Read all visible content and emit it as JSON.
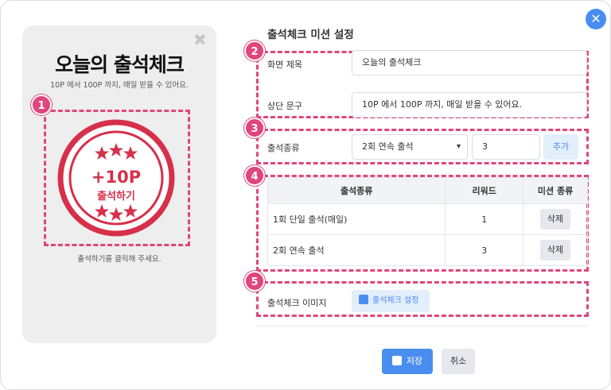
{
  "dialog": {
    "close_icon": "close-icon"
  },
  "preview": {
    "close_glyph": "✖",
    "title": "오늘의 출석체크",
    "subtitle": "10P 에서 100P 까지, 매일 받을 수 있어요.",
    "stamp_points": "+10P",
    "stamp_label": "출석하기",
    "hint": "출석하기를 클릭해 주세요."
  },
  "settings": {
    "title": "출석체크 미션 설정",
    "screen_title_label": "화면 제목",
    "screen_title_value": "오늘의 출석체크",
    "top_text_label": "상단 문구",
    "top_text_value": "10P 에서 100P 까지, 매일 받을 수 있어요.",
    "type_label": "출석종류",
    "type_selected": "2회 연속 출석",
    "type_reward_value": "3",
    "add_button": "추가",
    "image_label": "출석체크 이미지",
    "image_button": "출석체크 설정"
  },
  "table": {
    "headers": [
      "출석종류",
      "리워드",
      "미션 종류"
    ],
    "rows": [
      {
        "type": "1회 단일 출석(매일)",
        "reward": "1",
        "action": "삭제"
      },
      {
        "type": "2회 연속 출석",
        "reward": "3",
        "action": "삭제"
      }
    ]
  },
  "badges": [
    "1",
    "2",
    "3",
    "4",
    "5"
  ],
  "footer": {
    "save": "저장",
    "cancel": "취소"
  },
  "colors": {
    "accent": "#4a8df0",
    "highlight": "#e0457b",
    "stamp": "#d6304a"
  }
}
